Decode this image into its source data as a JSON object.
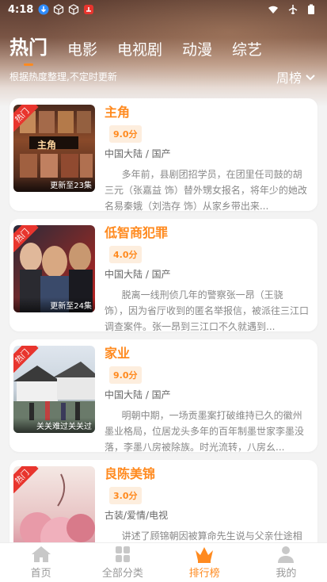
{
  "status_bar": {
    "time": "4:18"
  },
  "tabs": [
    {
      "label": "热门",
      "active": true
    },
    {
      "label": "电影",
      "active": false
    },
    {
      "label": "电视剧",
      "active": false
    },
    {
      "label": "动漫",
      "active": false
    },
    {
      "label": "综艺",
      "active": false
    }
  ],
  "subtitle": "根据热度整理,不定时更新",
  "rank_select": {
    "label": "周榜"
  },
  "items": [
    {
      "title": "主角",
      "score": "9.0分",
      "meta": "中国大陆 / 国产",
      "desc": "多年前，县剧团招学员，在团里任司鼓的胡三元（张嘉益 饰）替外甥女报名，将年少的她改名易秦娥（刘浩存 饰）从家乡带出来...",
      "tag": "热门",
      "update": "更新至23集"
    },
    {
      "title": "低智商犯罪",
      "score": "4.0分",
      "meta": "中国大陆 / 国产",
      "desc": "脱离一线刑侦几年的警察张一昂（王骁 饰），因为省厅收到的匿名举报信，被派往三江口调查案件。张一昂到三江口不久就遇到...",
      "tag": "热门",
      "update": "更新至24集"
    },
    {
      "title": "家业",
      "score": "9.0分",
      "meta": "中国大陆 / 国产",
      "desc": "明朝中期，一场贡墨案打破维持已久的徽州墨业格局，位居龙头多年的百年制墨世家李墨没落，李墨八房被除族。时光流转，八房幺...",
      "tag": "热门",
      "update": "关关难过关关过"
    },
    {
      "title": "良陈美锦",
      "score": "3.0分",
      "meta": "古装/爱情/电视",
      "desc": "讲述了顾锦朝因被算命先生说与父亲仕途相冲，从小寄养在外祖家，受外祖母宠爱，性格...",
      "tag": "热门",
      "update": ""
    }
  ],
  "bottom_nav": [
    {
      "label": "首页",
      "icon": "home-icon",
      "active": false
    },
    {
      "label": "全部分类",
      "icon": "category-icon",
      "active": false
    },
    {
      "label": "排行榜",
      "icon": "crown-icon",
      "active": true
    },
    {
      "label": "我的",
      "icon": "user-icon",
      "active": false
    }
  ],
  "colors": {
    "accent": "#ff8a1f",
    "tag": "#e8352e"
  }
}
